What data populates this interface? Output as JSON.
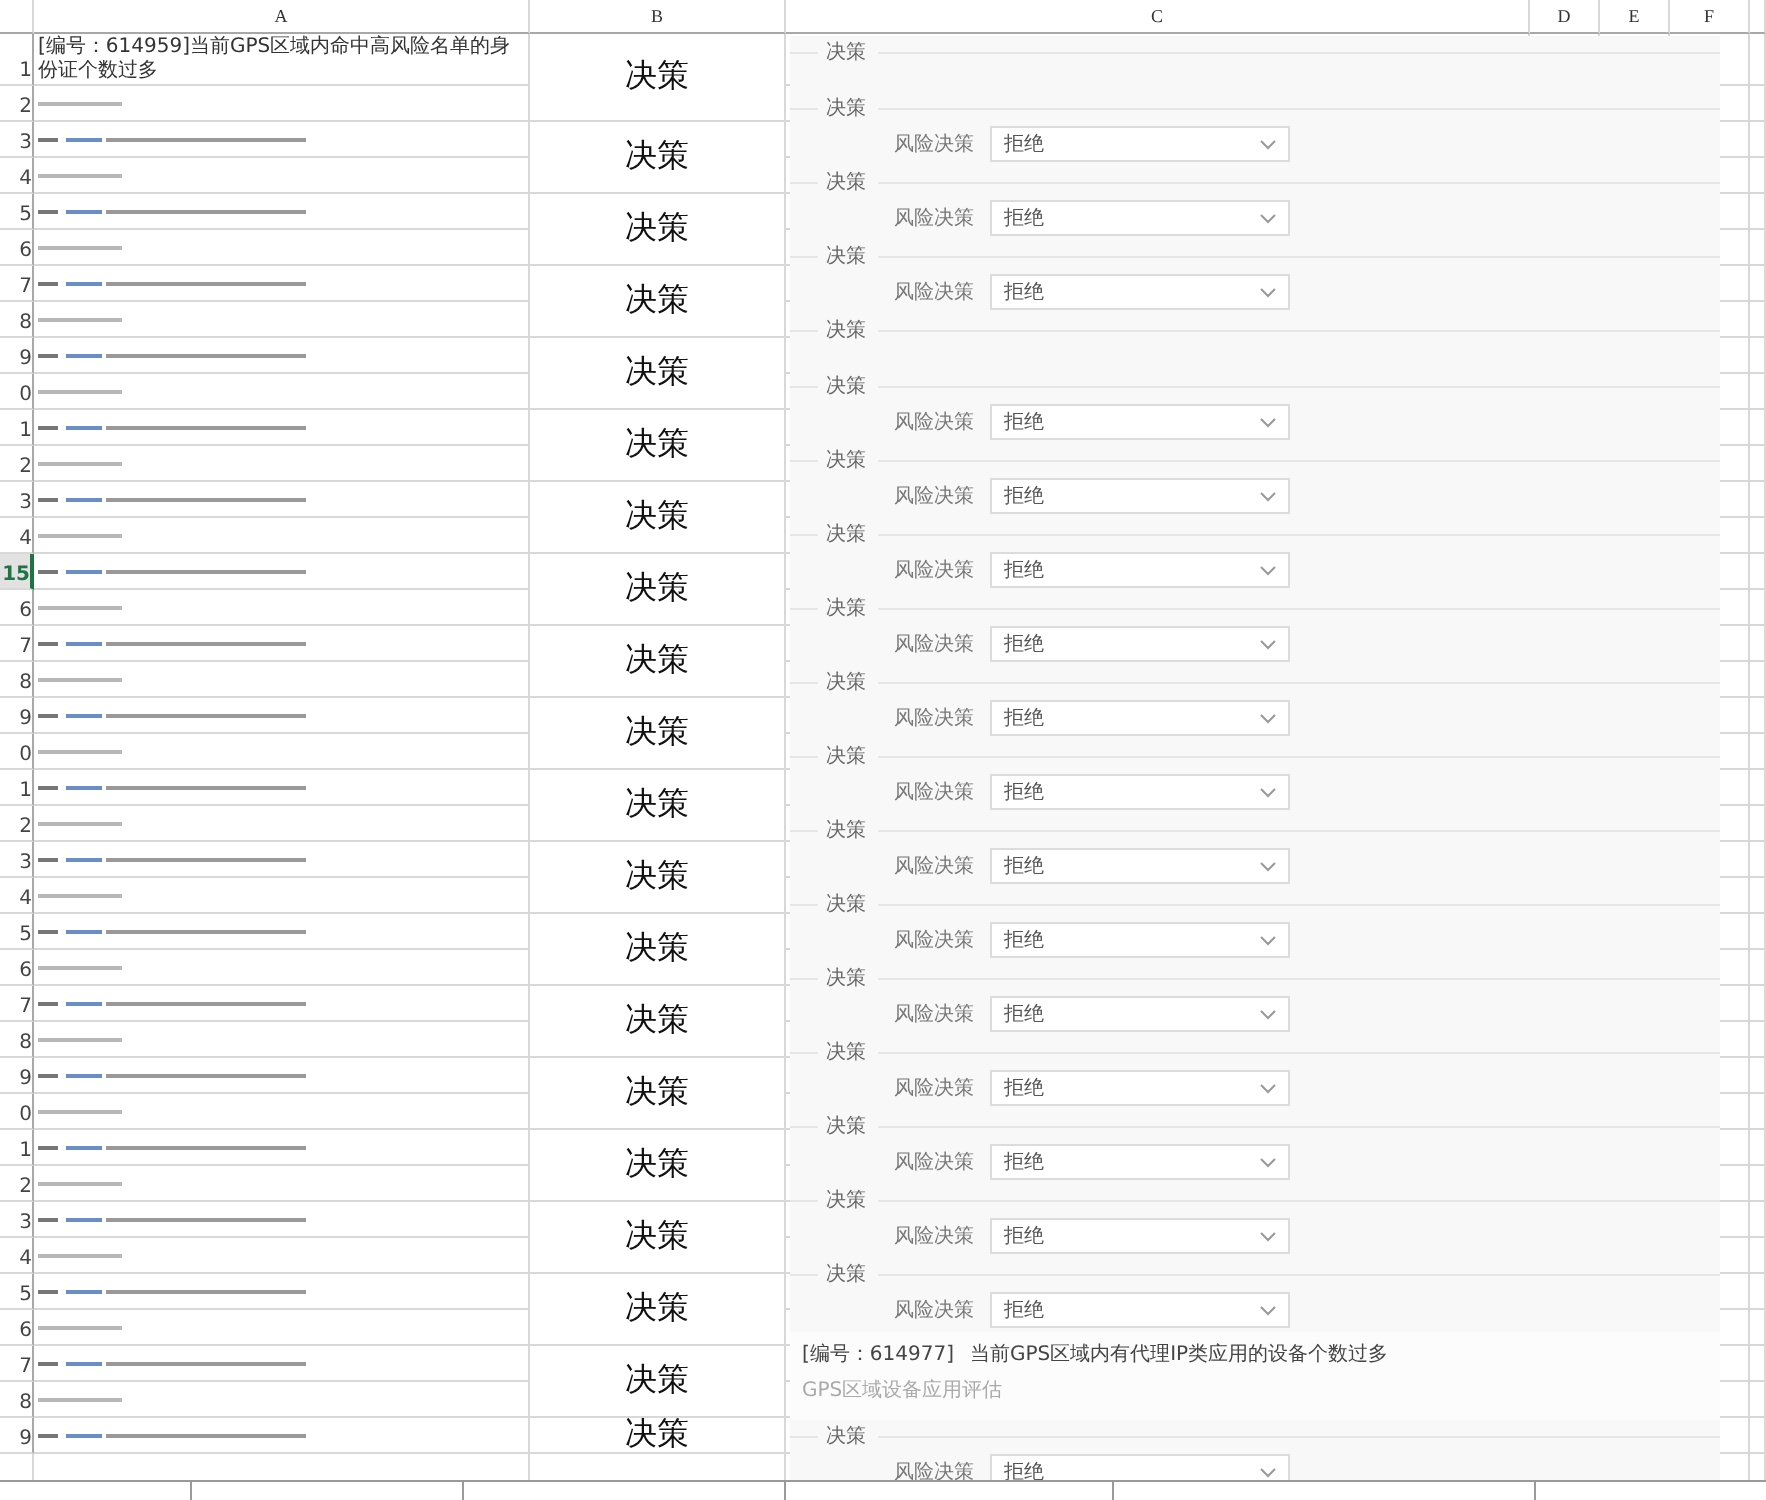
{
  "columns": [
    "A",
    "B",
    "C",
    "D",
    "E",
    "F"
  ],
  "rows": [
    {
      "number": "1",
      "selected": false,
      "kind": "text",
      "col_a": "[编号：614959]当前GPS区域内命中高风险名单的身份证个数过多",
      "col_b": "决策"
    },
    {
      "number": "2",
      "selected": false,
      "kind": "short"
    },
    {
      "number": "3",
      "selected": false,
      "kind": "long",
      "col_b": "决策"
    },
    {
      "number": "4",
      "selected": false,
      "kind": "short"
    },
    {
      "number": "5",
      "selected": false,
      "kind": "long",
      "col_b": "决策"
    },
    {
      "number": "6",
      "selected": false,
      "kind": "short"
    },
    {
      "number": "7",
      "selected": false,
      "kind": "long",
      "col_b": "决策"
    },
    {
      "number": "8",
      "selected": false,
      "kind": "short"
    },
    {
      "number": "9",
      "selected": false,
      "kind": "long",
      "col_b": "决策"
    },
    {
      "number": "0",
      "selected": false,
      "kind": "short"
    },
    {
      "number": "1",
      "selected": false,
      "kind": "long",
      "col_b": "决策"
    },
    {
      "number": "2",
      "selected": false,
      "kind": "short"
    },
    {
      "number": "3",
      "selected": false,
      "kind": "long",
      "col_b": "决策"
    },
    {
      "number": "4",
      "selected": false,
      "kind": "short"
    },
    {
      "number": "15",
      "selected": true,
      "kind": "long",
      "col_b": "决策"
    },
    {
      "number": "6",
      "selected": false,
      "kind": "short"
    },
    {
      "number": "7",
      "selected": false,
      "kind": "long",
      "col_b": "决策"
    },
    {
      "number": "8",
      "selected": false,
      "kind": "short"
    },
    {
      "number": "9",
      "selected": false,
      "kind": "long",
      "col_b": "决策"
    },
    {
      "number": "0",
      "selected": false,
      "kind": "short"
    },
    {
      "number": "1",
      "selected": false,
      "kind": "long",
      "col_b": "决策"
    },
    {
      "number": "2",
      "selected": false,
      "kind": "short"
    },
    {
      "number": "3",
      "selected": false,
      "kind": "long",
      "col_b": "决策"
    },
    {
      "number": "4",
      "selected": false,
      "kind": "short"
    },
    {
      "number": "5",
      "selected": false,
      "kind": "long",
      "col_b": "决策"
    },
    {
      "number": "6",
      "selected": false,
      "kind": "short"
    },
    {
      "number": "7",
      "selected": false,
      "kind": "long",
      "col_b": "决策"
    },
    {
      "number": "8",
      "selected": false,
      "kind": "short"
    },
    {
      "number": "9",
      "selected": false,
      "kind": "long",
      "col_b": "决策"
    },
    {
      "number": "0",
      "selected": false,
      "kind": "short"
    },
    {
      "number": "1",
      "selected": false,
      "kind": "long",
      "col_b": "决策"
    },
    {
      "number": "2",
      "selected": false,
      "kind": "short"
    },
    {
      "number": "3",
      "selected": false,
      "kind": "long",
      "col_b": "决策"
    },
    {
      "number": "4",
      "selected": false,
      "kind": "short"
    },
    {
      "number": "5",
      "selected": false,
      "kind": "long",
      "col_b": "决策"
    },
    {
      "number": "6",
      "selected": false,
      "kind": "short"
    },
    {
      "number": "7",
      "selected": false,
      "kind": "long",
      "col_b": "决策"
    },
    {
      "number": "8",
      "selected": false,
      "kind": "short"
    },
    {
      "number": "9",
      "selected": false,
      "kind": "long",
      "col_b": "决策"
    }
  ],
  "panels": [
    {
      "kind": "legend",
      "legend": "决策"
    },
    {
      "kind": "decision",
      "legend": "决策",
      "label": "风险决策",
      "value": "拒绝"
    },
    {
      "kind": "decision",
      "legend": "决策",
      "label": "风险决策",
      "value": "拒绝"
    },
    {
      "kind": "decision",
      "legend": "决策",
      "label": "风险决策",
      "value": "拒绝"
    },
    {
      "kind": "legend",
      "legend": "决策"
    },
    {
      "kind": "decision",
      "legend": "决策",
      "label": "风险决策",
      "value": "拒绝"
    },
    {
      "kind": "decision",
      "legend": "决策",
      "label": "风险决策",
      "value": "拒绝"
    },
    {
      "kind": "decision",
      "legend": "决策",
      "label": "风险决策",
      "value": "拒绝"
    },
    {
      "kind": "decision",
      "legend": "决策",
      "label": "风险决策",
      "value": "拒绝"
    },
    {
      "kind": "decision",
      "legend": "决策",
      "label": "风险决策",
      "value": "拒绝"
    },
    {
      "kind": "decision",
      "legend": "决策",
      "label": "风险决策",
      "value": "拒绝"
    },
    {
      "kind": "decision",
      "legend": "决策",
      "label": "风险决策",
      "value": "拒绝"
    },
    {
      "kind": "decision",
      "legend": "决策",
      "label": "风险决策",
      "value": "拒绝"
    },
    {
      "kind": "decision",
      "legend": "决策",
      "label": "风险决策",
      "value": "拒绝"
    },
    {
      "kind": "decision",
      "legend": "决策",
      "label": "风险决策",
      "value": "拒绝"
    },
    {
      "kind": "decision",
      "legend": "决策",
      "label": "风险决策",
      "value": "拒绝"
    },
    {
      "kind": "decision",
      "legend": "决策",
      "label": "风险决策",
      "value": "拒绝"
    },
    {
      "kind": "decision",
      "legend": "决策",
      "label": "风险决策",
      "value": "拒绝"
    },
    {
      "kind": "rule",
      "code": "[编号：614977]",
      "title": "当前GPS区域内有代理IP类应用的设备个数过多",
      "subtitle": "GPS区域设备应用评估"
    },
    {
      "kind": "decision",
      "legend": "决策",
      "label": "风险决策",
      "value": "拒绝"
    }
  ]
}
